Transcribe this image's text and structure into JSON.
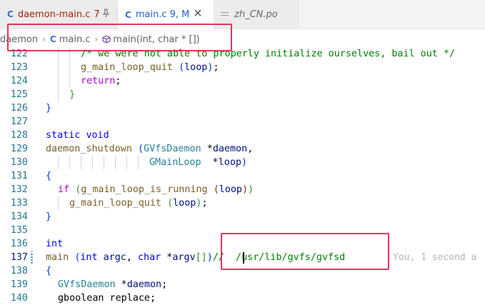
{
  "tabs": [
    {
      "icon": "C",
      "name": "daemon-main.c",
      "badge": "7",
      "pinned": true
    },
    {
      "icon": "C",
      "name": "main.c",
      "badge": "9, M",
      "active": true
    },
    {
      "icon": "po-file-icon",
      "name": "zh_CN.po"
    }
  ],
  "breadcrumb": {
    "folder": "daemon",
    "file_icon": "C",
    "file": "main.c",
    "symbol": "main(int, char * [])"
  },
  "editor": {
    "lines": [
      "122",
      "123",
      "124",
      "125",
      "126",
      "127",
      "128",
      "129",
      "130",
      "131",
      "132",
      "133",
      "134",
      "135",
      "136",
      "137",
      "138",
      "139",
      "140"
    ],
    "active_line": "137",
    "code": {
      "l122": "/* we were not able to properly initialize ourselves, bail out */",
      "l123a": "g_main_loop_quit",
      "l123b": "loop",
      "l124": "return",
      "l128a": "static",
      "l128b": "void",
      "l129a": "daemon_shutdown",
      "l129b": "GVfsDaemon",
      "l129c": "daemon",
      "l130a": "GMainLoop",
      "l130b": "loop",
      "l132a": "if",
      "l132b": "g_main_loop_is_running",
      "l132c": "loop",
      "l133a": "g_main_loop_quit",
      "l133b": "loop",
      "l136": "int",
      "l137a": "main",
      "l137b": "int",
      "l137c": "argc",
      "l137d": "char",
      "l137e": "argv",
      "l137f": "//  /usr/lib/gvfs/gvfsd",
      "l139a": "GVfsDaemon",
      "l139b": "daemon",
      "l140": "gboolean replace;"
    },
    "ghost_text": "You, 1 second a"
  }
}
